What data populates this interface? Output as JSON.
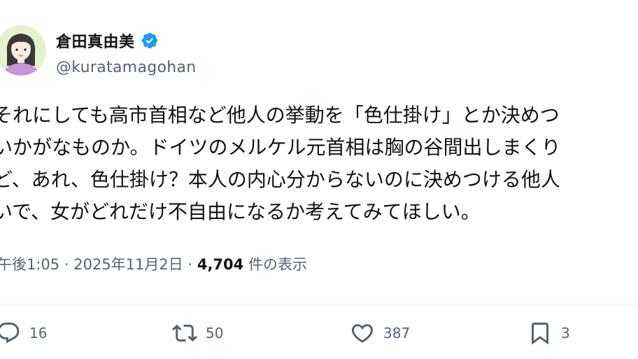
{
  "author": {
    "display_name": "倉田真由美",
    "handle": "@kuratamagohan",
    "verified_color": "#1d9bf0"
  },
  "tweet": {
    "lines": [
      "それにしても高市首相など他人の挙動を「色仕掛け」とか決めつ",
      "いかがなものか。ドイツのメルケル元首相は胸の谷間出しまくり",
      "ど、あれ、色仕掛け？本人の内心分からないのに決めつける他人",
      "いで、女がどれだけ不自由になるか考えてみてほしい。"
    ]
  },
  "meta": {
    "time": "午後1:05",
    "separator": "·",
    "date": "2025年11月2日",
    "views_count": "4,704",
    "views_label": "件の表示"
  },
  "actions": {
    "reply_count": "16",
    "retweet_count": "50",
    "like_count": "387",
    "bookmark_count": "3"
  },
  "icons": {
    "reply": "reply-icon",
    "retweet": "retweet-icon",
    "like": "heart-icon",
    "bookmark": "bookmark-icon",
    "verified": "verified-badge-icon"
  }
}
